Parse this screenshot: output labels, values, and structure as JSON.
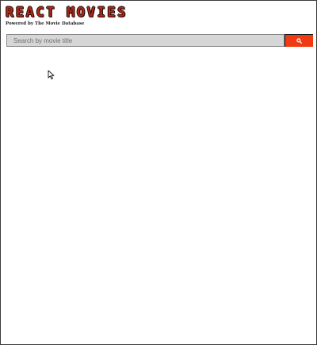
{
  "app": {
    "title": "REACT MOVIES",
    "subtitle": "Powered by The Movie Database"
  },
  "search": {
    "placeholder": "Search by movie title",
    "value": "",
    "button_icon": "search-icon"
  },
  "colors": {
    "brand_red": "#b32717",
    "search_button": "#f03a11",
    "search_field": "#d6d6d6"
  }
}
